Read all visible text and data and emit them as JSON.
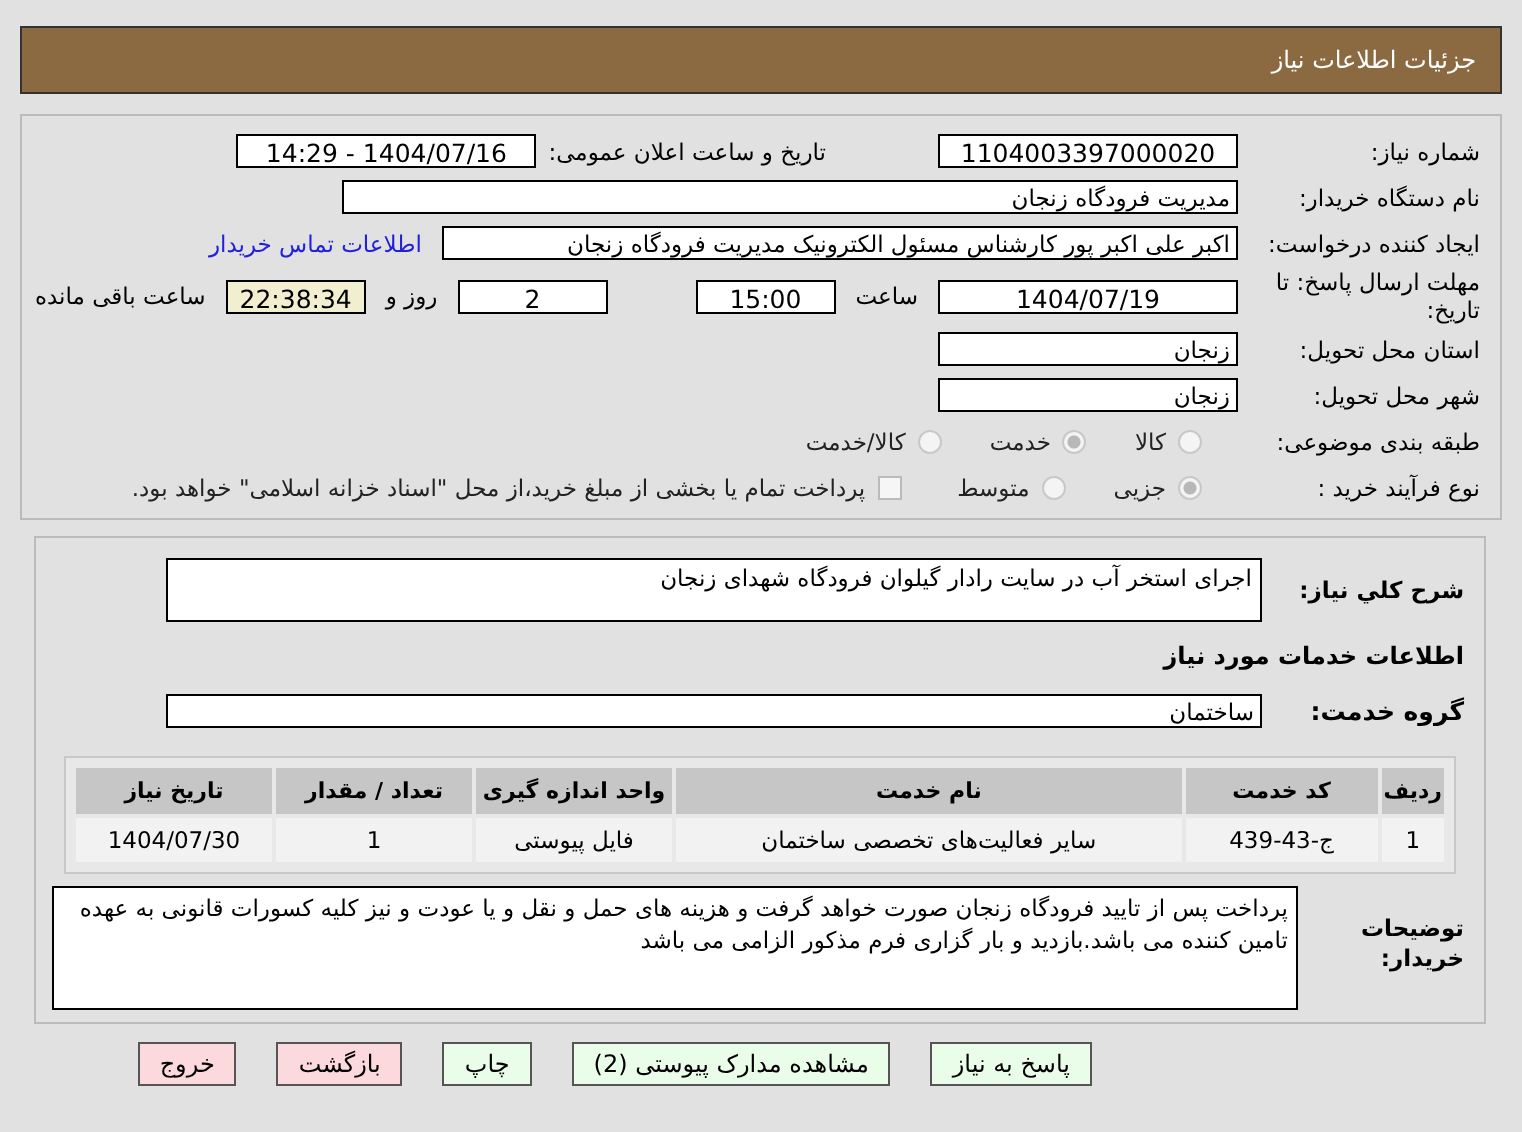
{
  "header": {
    "title": "جزئیات اطلاعات نیاز"
  },
  "need_number": {
    "label": "شماره نیاز:",
    "value": "1104003397000020"
  },
  "announce": {
    "label": "تاریخ و ساعت اعلان عمومی:",
    "value": "1404/07/16 - 14:29"
  },
  "buyer": {
    "label": "نام دستگاه خریدار:",
    "value": "مدیریت فرودگاه زنجان"
  },
  "creator": {
    "label": "ایجاد کننده درخواست:",
    "value": "اکبر علی اکبر پور کارشناس مسئول الکترونیک مدیریت فرودگاه زنجان",
    "link": "اطلاعات تماس خریدار"
  },
  "deadline": {
    "label": "مهلت ارسال پاسخ: تا تاریخ:",
    "date": "1404/07/19",
    "time_label": "ساعت",
    "time": "15:00",
    "days": "2",
    "days_label": "روز و",
    "remaining": "22:38:34",
    "remaining_label": "ساعت باقی مانده"
  },
  "province": {
    "label": "استان محل تحویل:",
    "value": "زنجان"
  },
  "city": {
    "label": "شهر محل تحویل:",
    "value": "زنجان"
  },
  "category": {
    "label": "طبقه بندی موضوعی:",
    "options": [
      {
        "label": "کالا",
        "selected": false
      },
      {
        "label": "خدمت",
        "selected": true
      },
      {
        "label": "کالا/خدمت",
        "selected": false
      }
    ]
  },
  "purchase_type": {
    "label": "نوع فرآیند خرید :",
    "options": [
      {
        "label": "جزیی",
        "selected": true
      },
      {
        "label": "متوسط",
        "selected": false
      }
    ],
    "checkbox": {
      "label": "پرداخت تمام یا بخشی از مبلغ خرید،از محل \"اسناد خزانه اسلامی\" خواهد بود.",
      "checked": false
    }
  },
  "description": {
    "label": "شرح کلي نیاز:",
    "value": "اجرای استخر آب در سایت رادار گیلوان فرودگاه شهدای زنجان"
  },
  "services_title": "اطلاعات خدمات مورد نیاز",
  "service_group": {
    "label": "گروه خدمت:",
    "value": "ساختمان"
  },
  "table": {
    "columns": [
      "ردیف",
      "کد خدمت",
      "نام خدمت",
      "واحد اندازه گیری",
      "تعداد / مقدار",
      "تاریخ نیاز"
    ],
    "rows": [
      [
        "1",
        "ج-43-439",
        "سایر فعالیت‌های تخصصی ساختمان",
        "فایل پیوستی",
        "1",
        "1404/07/30"
      ]
    ]
  },
  "buyer_notes": {
    "label": "توضیحات خریدار:",
    "value": "پرداخت پس از تایید فرودگاه زنجان صورت خواهد گرفت و هزینه های حمل و نقل و یا عودت و نیز کلیه کسورات قانونی به عهده تامین کننده می باشد.بازدید و بار گزاری فرم مذکور الزامی می باشد"
  },
  "buttons": [
    {
      "label": "پاسخ به نیاز",
      "kind": "green"
    },
    {
      "label": "مشاهده مدارک پیوستی (2)",
      "kind": "green"
    },
    {
      "label": "چاپ",
      "kind": "green"
    },
    {
      "label": "بازگشت",
      "kind": "pink"
    },
    {
      "label": "خروج",
      "kind": "pink"
    }
  ]
}
